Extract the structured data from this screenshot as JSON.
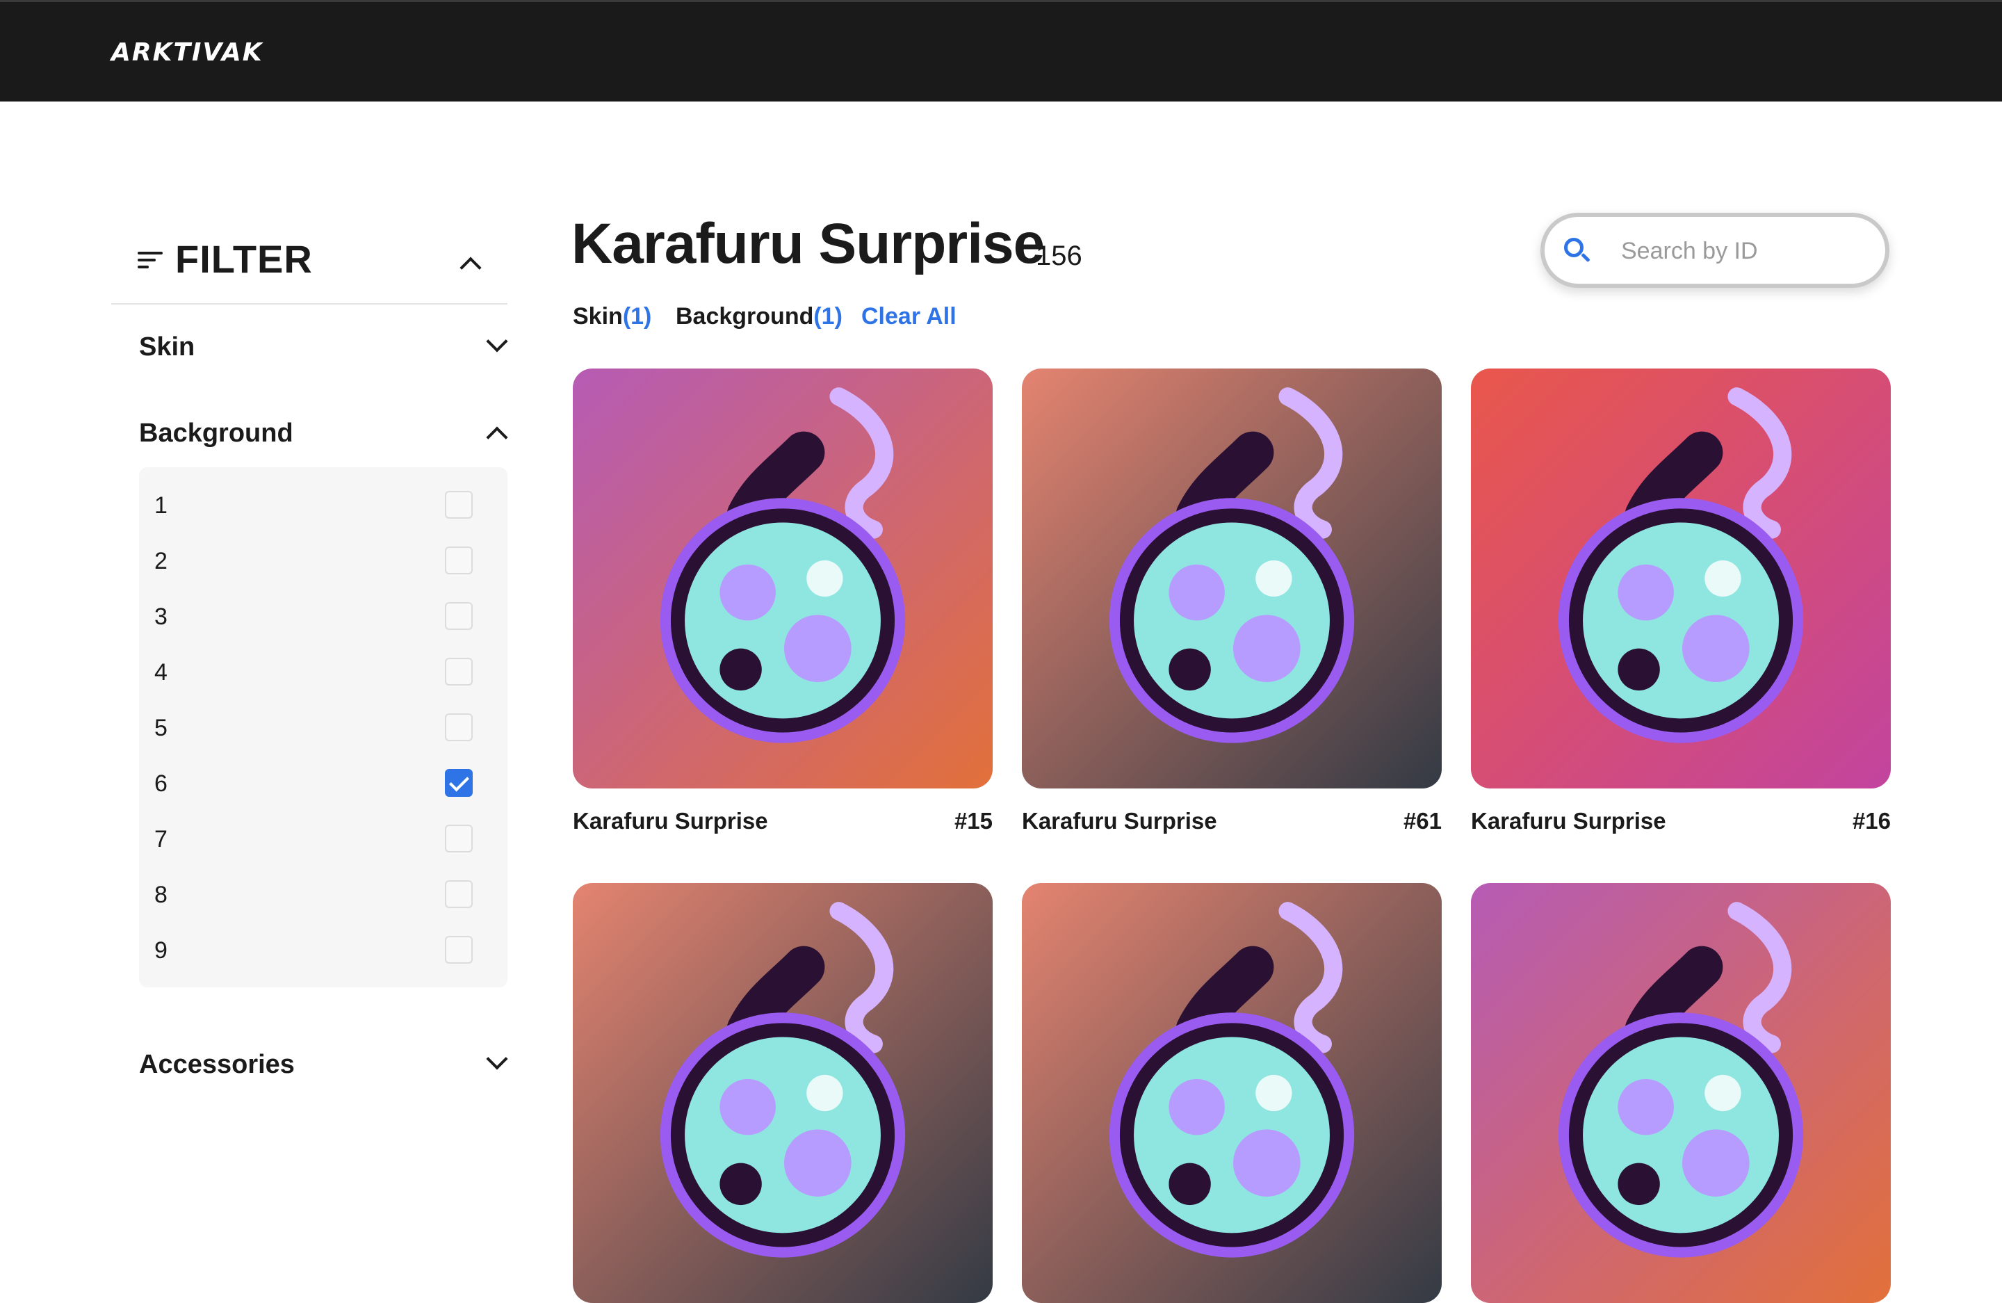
{
  "header": {
    "logo": "ARKTIVAK"
  },
  "sidebar": {
    "filter_title": "FILTER",
    "sections": [
      {
        "label": "Skin",
        "expanded": false
      },
      {
        "label": "Background",
        "expanded": true
      },
      {
        "label": "Accessories",
        "expanded": false
      }
    ],
    "background_options": [
      {
        "label": "1",
        "checked": false
      },
      {
        "label": "2",
        "checked": false
      },
      {
        "label": "3",
        "checked": false
      },
      {
        "label": "4",
        "checked": false
      },
      {
        "label": "5",
        "checked": false
      },
      {
        "label": "6",
        "checked": true
      },
      {
        "label": "7",
        "checked": false
      },
      {
        "label": "8",
        "checked": false
      },
      {
        "label": "9",
        "checked": false
      }
    ]
  },
  "main": {
    "title": "Karafuru Surprise",
    "count": "156",
    "search_placeholder": "Search by ID",
    "chips": [
      {
        "label": "Skin",
        "count": "(1)"
      },
      {
        "label": "Background",
        "count": "(1)"
      }
    ],
    "clear_all": "Clear All",
    "cards": [
      {
        "name": "Karafuru Surprise",
        "id": "#15",
        "bg": [
          "#b65bb5",
          "#e2703a"
        ]
      },
      {
        "name": "Karafuru Surprise",
        "id": "#61",
        "bg": [
          "#e48470",
          "#333a44"
        ]
      },
      {
        "name": "Karafuru Surprise",
        "id": "#16",
        "bg": [
          "#e9574b",
          "#c2449e"
        ]
      },
      {
        "name": "",
        "id": "",
        "bg": [
          "#e48470",
          "#333a44"
        ]
      },
      {
        "name": "",
        "id": "",
        "bg": [
          "#e48470",
          "#333a44"
        ]
      },
      {
        "name": "",
        "id": "",
        "bg": [
          "#b65bb5",
          "#e2703a"
        ]
      }
    ]
  }
}
